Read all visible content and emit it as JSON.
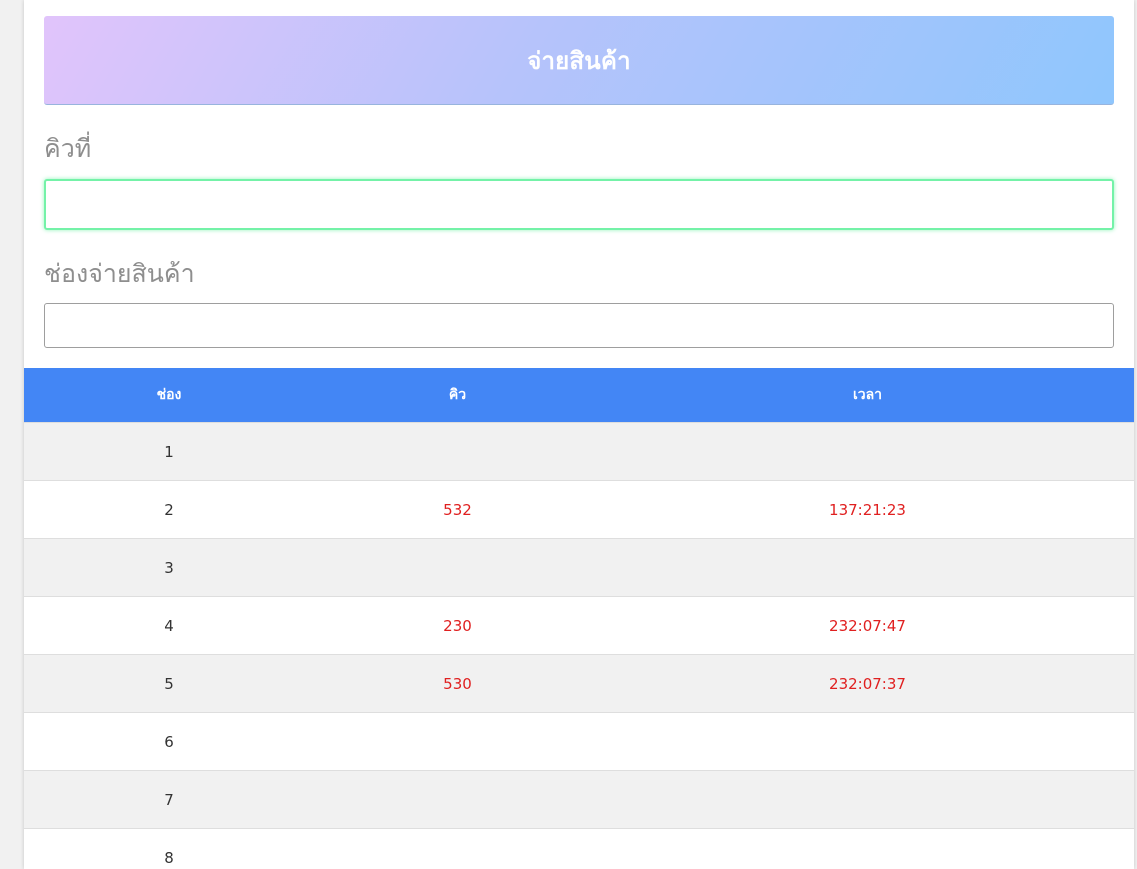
{
  "header": {
    "title": "จ่ายสินค้า"
  },
  "form": {
    "queue_label": "คิวที่",
    "queue_value": "",
    "counter_label": "ช่องจ่ายสินค้า",
    "counter_value": ""
  },
  "table": {
    "columns": [
      "ช่อง",
      "คิว",
      "เวลา"
    ],
    "rows": [
      {
        "counter": "1",
        "queue": "",
        "time": ""
      },
      {
        "counter": "2",
        "queue": "532",
        "time": "137:21:23"
      },
      {
        "counter": "3",
        "queue": "",
        "time": ""
      },
      {
        "counter": "4",
        "queue": "230",
        "time": "232:07:47"
      },
      {
        "counter": "5",
        "queue": "530",
        "time": "232:07:37"
      },
      {
        "counter": "6",
        "queue": "",
        "time": ""
      },
      {
        "counter": "7",
        "queue": "",
        "time": ""
      },
      {
        "counter": "8",
        "queue": "",
        "time": ""
      }
    ]
  },
  "colors": {
    "header_row": "#4386f5",
    "active_value": "#e02020",
    "focus_border": "#74f2a8"
  }
}
